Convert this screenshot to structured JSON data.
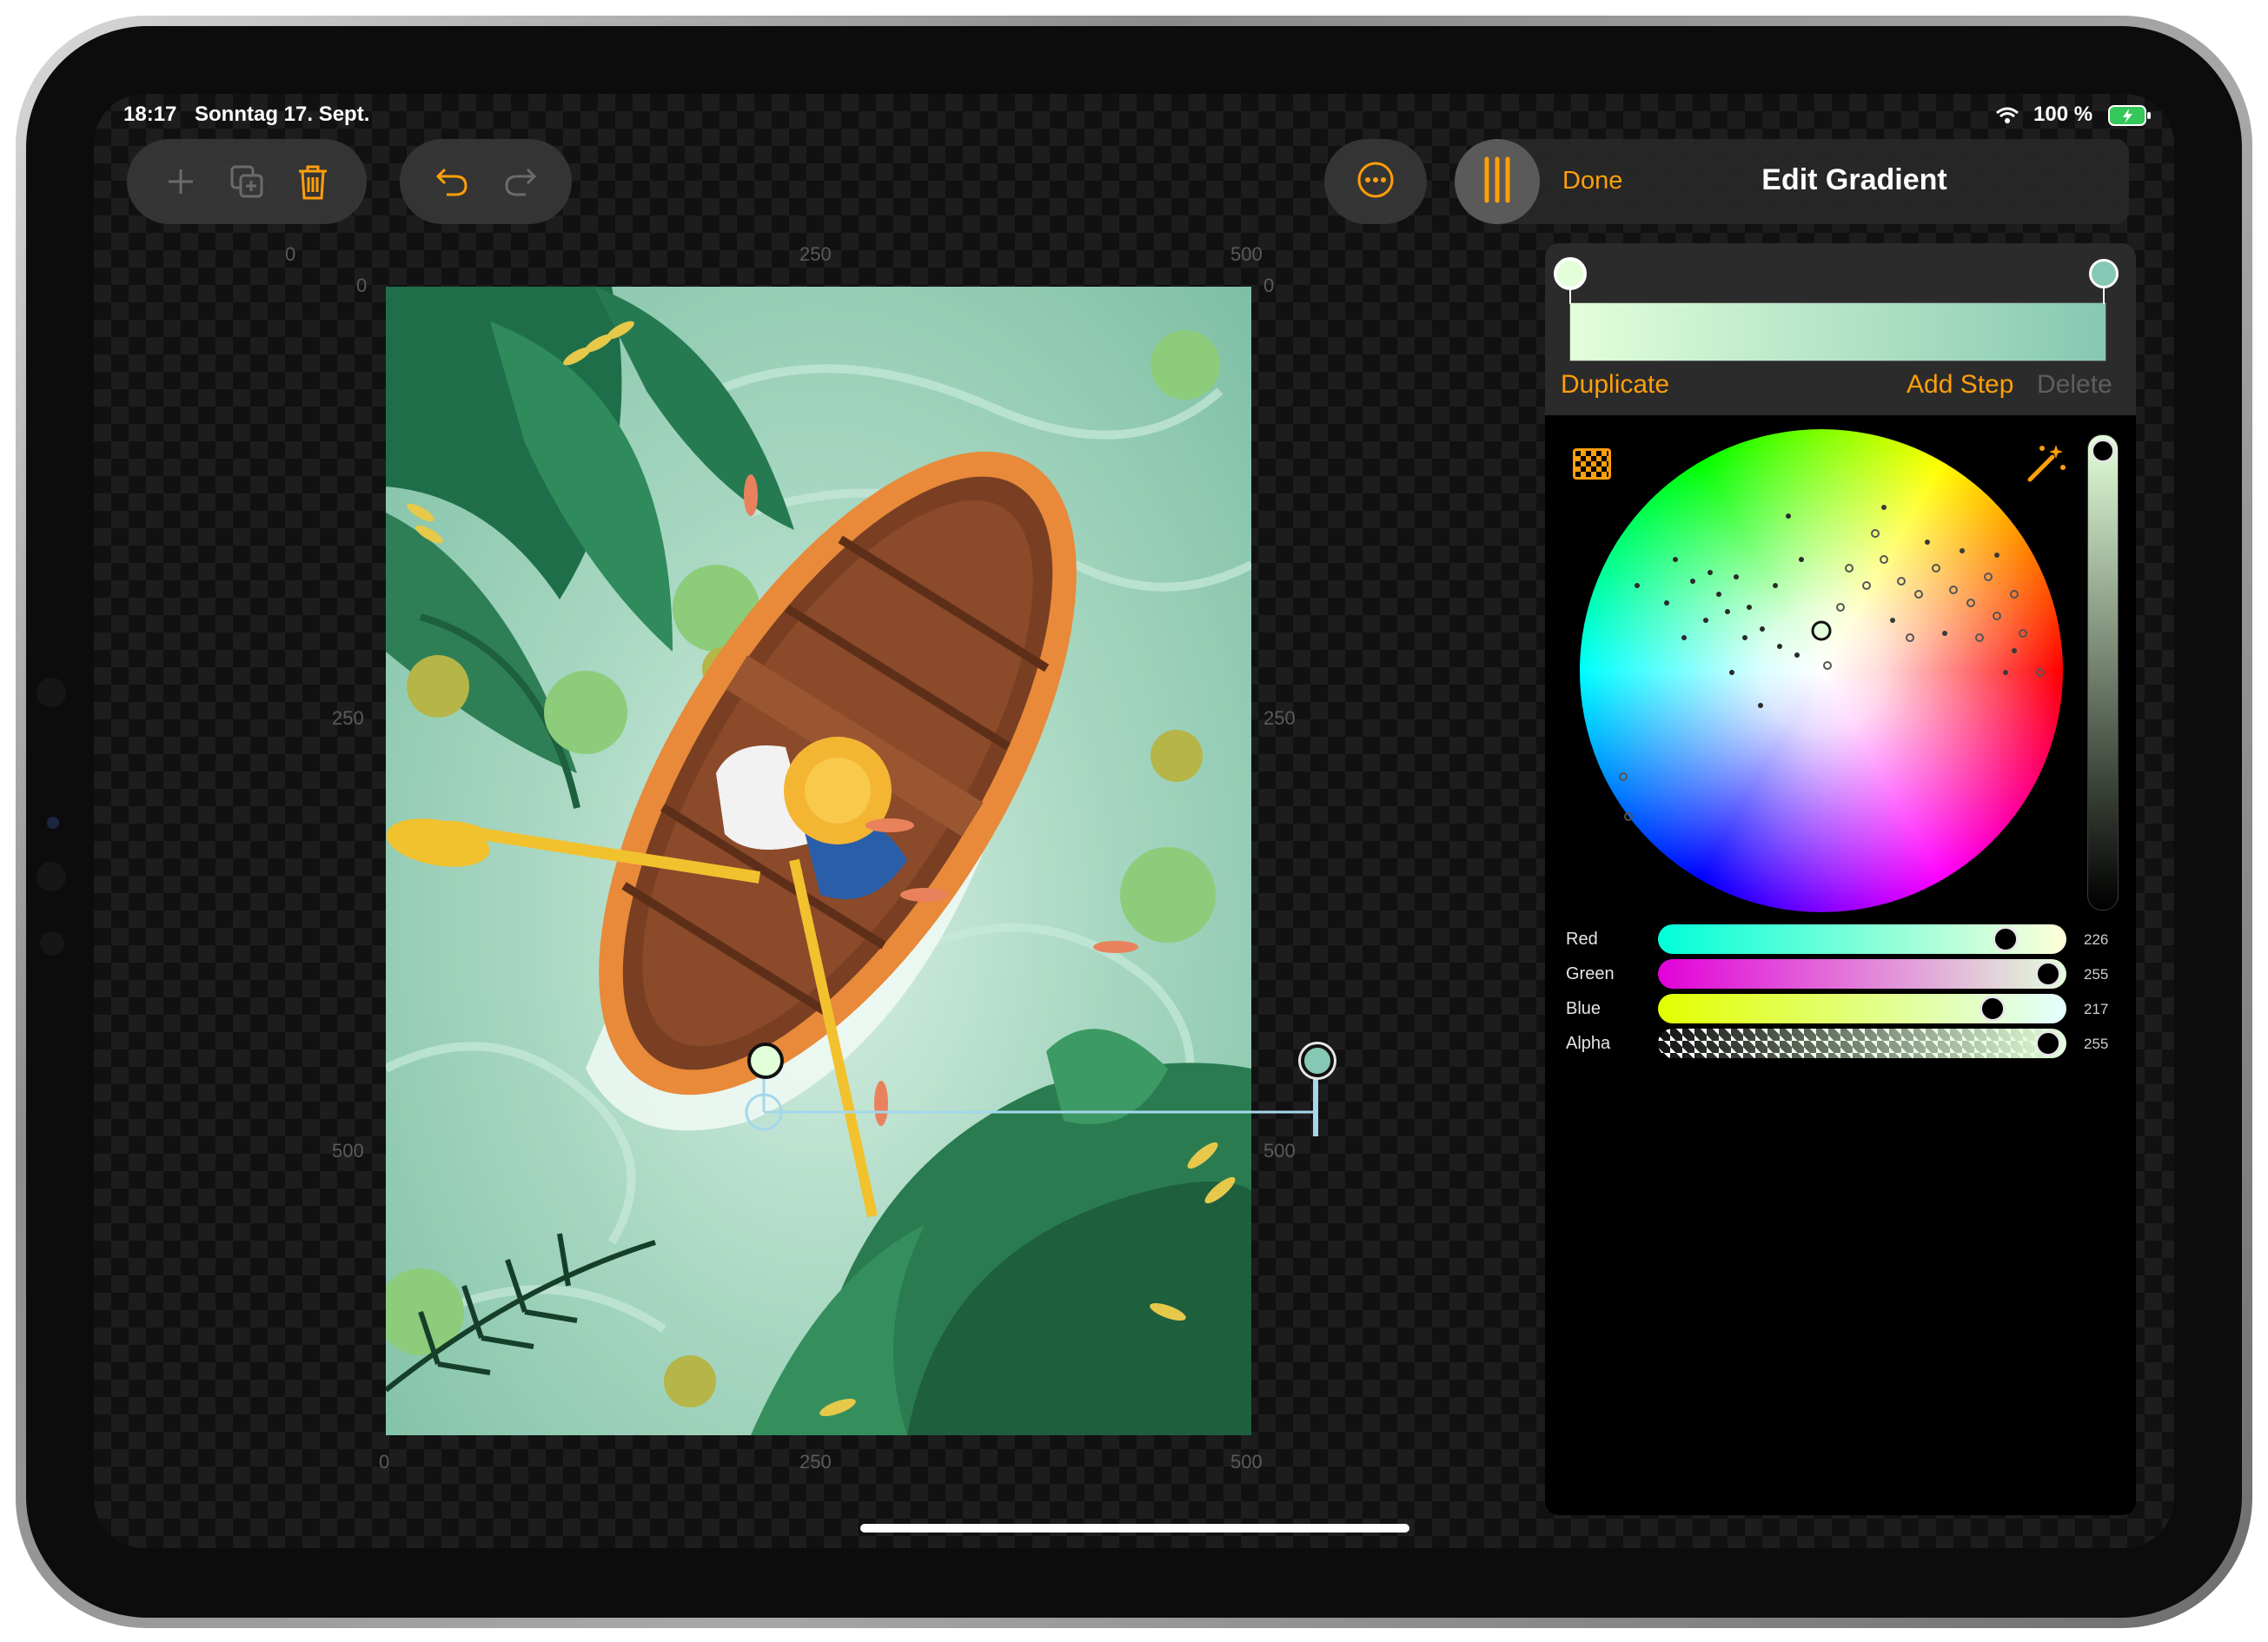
{
  "status_bar": {
    "time": "18:17",
    "date": "Sonntag 17. Sept.",
    "battery": "100 %"
  },
  "toolbar": {
    "left_group": [
      "plus-icon",
      "duplicate-icon",
      "trash-icon"
    ],
    "history_group": [
      "undo-icon",
      "redo-icon"
    ],
    "more": "ellipsis-icon",
    "panel_toggle": "sliders-icon",
    "done_label": "Done",
    "title": "Edit Gradient"
  },
  "rulers": {
    "top": [
      "0",
      "250",
      "500"
    ],
    "bottom": [
      "0",
      "250",
      "500"
    ],
    "left": [
      "0",
      "250",
      "500"
    ],
    "right": [
      "0",
      "250",
      "500"
    ]
  },
  "gradient_editor": {
    "start_color": "#e2ffd9",
    "end_color": "#86c8b3",
    "duplicate_label": "Duplicate",
    "add_step_label": "Add Step",
    "delete_label": "Delete"
  },
  "color_picker": {
    "checker_icon": "checkerboard-icon",
    "magic_icon": "magic-wand-icon"
  },
  "sliders": [
    {
      "label": "Red",
      "value": "226",
      "level": 0.886
    },
    {
      "label": "Green",
      "value": "255",
      "level": 1.0
    },
    {
      "label": "Blue",
      "value": "217",
      "level": 0.851
    },
    {
      "label": "Alpha",
      "value": "255",
      "level": 1.0
    }
  ],
  "colors": {
    "accent": "#ff9f0a",
    "panel_bg": "#000000"
  }
}
